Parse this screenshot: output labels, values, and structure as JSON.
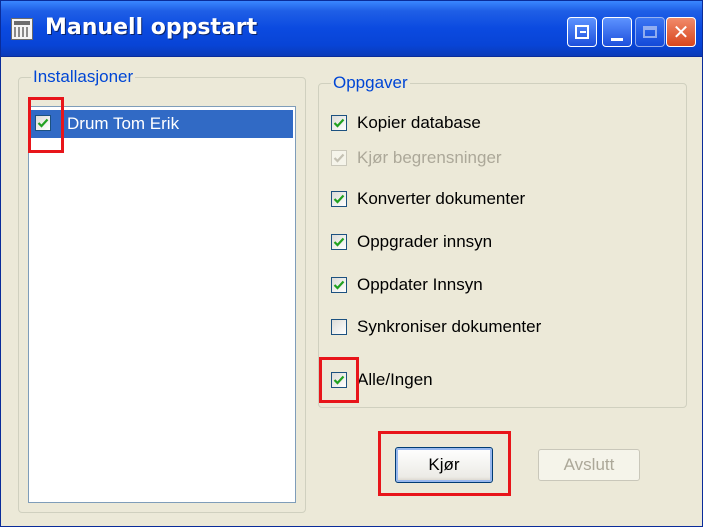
{
  "window": {
    "title": "Manuell oppstart",
    "title_buttons": [
      "help-icon",
      "minimize-icon",
      "maximize-icon",
      "close-icon"
    ]
  },
  "installations": {
    "legend": "Installasjoner",
    "items": [
      {
        "label": "Drum Tom Erik",
        "checked": true,
        "selected": true
      }
    ]
  },
  "tasks": {
    "legend": "Oppgaver",
    "items": [
      {
        "label": "Kopier database",
        "checked": true,
        "enabled": true
      },
      {
        "label": "Kjør begrensninger",
        "checked": true,
        "enabled": false
      },
      {
        "label": "Konverter dokumenter",
        "checked": true,
        "enabled": true
      },
      {
        "label": "Oppgrader innsyn",
        "checked": true,
        "enabled": true
      },
      {
        "label": "Oppdater Innsyn",
        "checked": true,
        "enabled": true
      },
      {
        "label": "Synkroniser dokumenter",
        "checked": false,
        "enabled": true
      },
      {
        "label": "Alle/Ingen",
        "checked": true,
        "enabled": true
      }
    ]
  },
  "buttons": {
    "run_label": "Kjør",
    "exit_label": "Avslutt",
    "exit_enabled": false
  },
  "colors": {
    "titlebar": "#0b4ae0",
    "legend_text": "#0046d5",
    "selection": "#316ac5",
    "highlight": "#e8151a",
    "check_green": "#21a121"
  }
}
